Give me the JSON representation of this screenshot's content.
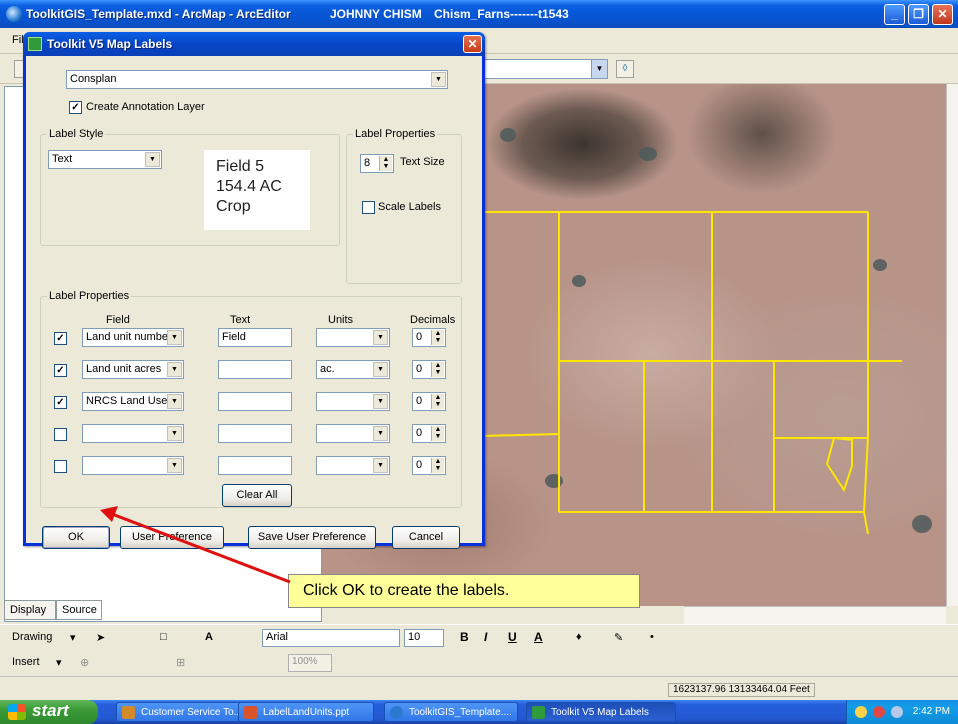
{
  "window": {
    "title": "ToolkitGIS_Template.mxd - ArcMap - ArcEditor",
    "user": "JOHNNY CHISM",
    "document": "Chism_Farns-------t1543",
    "controls": {
      "minimize": "_",
      "maximize": "❐",
      "close": "✕"
    }
  },
  "menubar": {
    "first_item": "Fil"
  },
  "toc": {
    "tabs": [
      "Display",
      "Source"
    ]
  },
  "dialog": {
    "title": "Toolkit V5 Map Labels",
    "close": "✕",
    "layer_select": "Consplan",
    "create_annotation_label": "Create Annotation Layer",
    "create_annotation_checked": true,
    "label_style": {
      "caption": "Label Style",
      "style_select": "Text",
      "preview_lines": [
        "Field 5",
        "154.4 AC",
        "Crop"
      ]
    },
    "label_props_top": {
      "caption": "Label Properties",
      "text_size": "8",
      "text_size_label": "Text Size",
      "scale_labels_label": "Scale Labels",
      "scale_labels_checked": false
    },
    "label_props": {
      "caption": "Label Properties",
      "headers": {
        "field": "Field",
        "text": "Text",
        "units": "Units",
        "decimals": "Decimals"
      },
      "rows": [
        {
          "checked": true,
          "field": "Land unit number",
          "text": "Field",
          "units": "",
          "decimals": "0"
        },
        {
          "checked": true,
          "field": "Land unit acres",
          "text": "",
          "units": "ac.",
          "decimals": "0"
        },
        {
          "checked": true,
          "field": "NRCS Land Use",
          "text": "",
          "units": "",
          "decimals": "0"
        },
        {
          "checked": false,
          "field": "",
          "text": "",
          "units": "",
          "decimals": "0"
        },
        {
          "checked": false,
          "field": "",
          "text": "",
          "units": "",
          "decimals": "0"
        }
      ],
      "clear_all": "Clear All"
    },
    "buttons": {
      "ok": "OK",
      "user_pref": "User Preference",
      "save_user_pref": "Save User Preference",
      "cancel": "Cancel"
    }
  },
  "callout": {
    "text": "Click OK to create the labels."
  },
  "drawing_toolbar": {
    "drawing_label": "Drawing",
    "font": "Arial",
    "font_size": "10",
    "bold": "B",
    "italic": "I",
    "underline": "U",
    "font_color": "A"
  },
  "insert_toolbar": {
    "insert_label": "Insert",
    "zoom": "100%"
  },
  "statusbar": {
    "coordinates": "1623137.96  13133464.04 Feet"
  },
  "taskbar": {
    "start": "start",
    "tasks": [
      {
        "label": "Customer Service To...",
        "color": "#d08a2a"
      },
      {
        "label": "LabelLandUnits.ppt",
        "color": "#d9542a"
      },
      {
        "label": "ToolkitGIS_Template....",
        "color": "#2a7ad0"
      },
      {
        "label": "Toolkit V5 Map Labels",
        "color": "#2f9b3a"
      }
    ],
    "clock": "2:42 PM"
  },
  "colors": {
    "title_blue": "#0a5fe0",
    "field_boundary": "#ffe600",
    "callout_bg": "#ffff99",
    "arrow": "#e01010"
  }
}
